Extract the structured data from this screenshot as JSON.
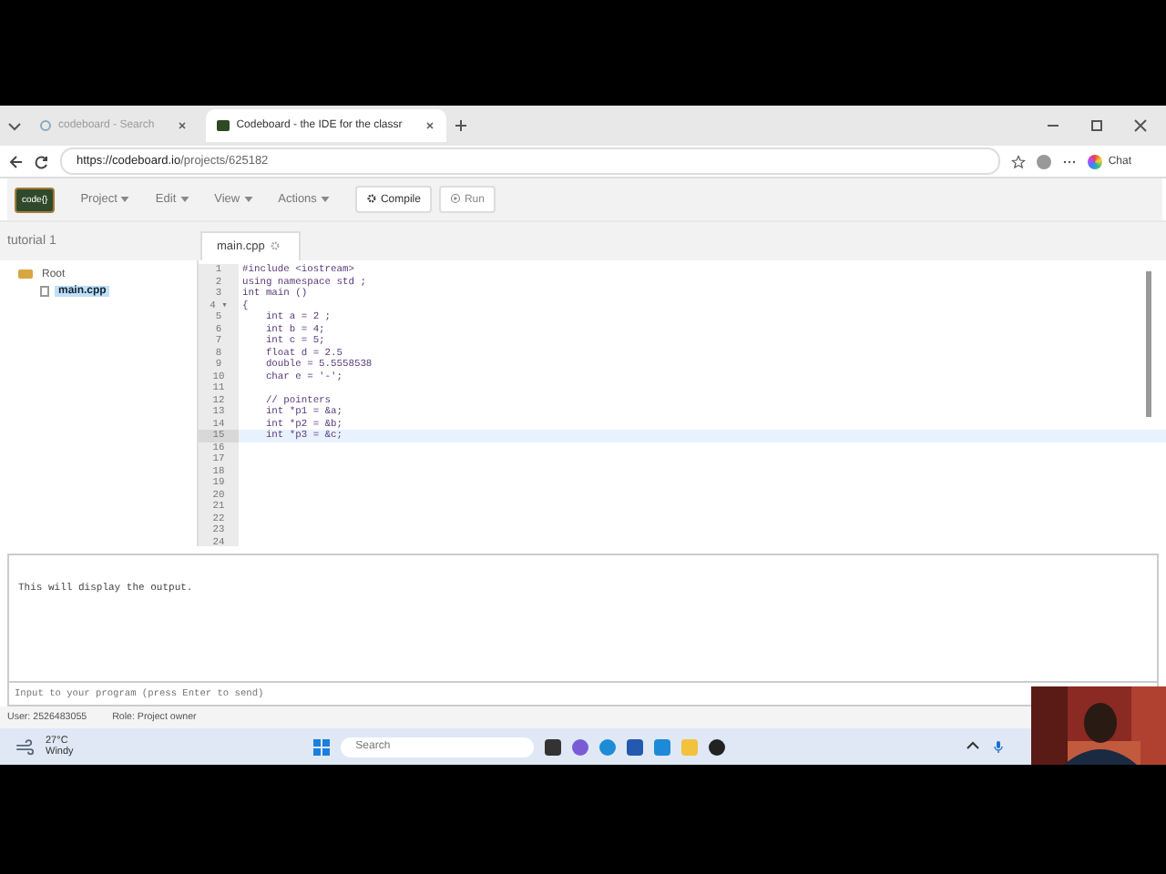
{
  "browser": {
    "tabs": [
      {
        "title": "codeboard - Search",
        "selected": false
      },
      {
        "title": "Codeboard - the IDE for the classr",
        "selected": true
      }
    ],
    "url_host": "https://codeboard.io",
    "url_path": "/projects/625182",
    "chat": "Chat"
  },
  "app": {
    "logo": "code{}",
    "menus": [
      "Project",
      "Edit",
      "View",
      "Actions"
    ],
    "buttons": [
      {
        "kind": "compile",
        "label": "Compile"
      },
      {
        "kind": "run",
        "label": "Run"
      }
    ],
    "project": "tutorial 1",
    "tree": [
      {
        "label": "Root",
        "selected": false,
        "children": [
          {
            "label": "main.cpp",
            "selected": true
          }
        ]
      }
    ],
    "editor_tab": "main.cpp",
    "lines": [
      {
        "n": "1",
        "text": "#include <iostream>",
        "current": false
      },
      {
        "n": "2",
        "text": "using namespace std ;",
        "current": false
      },
      {
        "n": "3",
        "text": "int main ()",
        "current": false
      },
      {
        "n": "4 ▾",
        "text": "{",
        "current": false
      },
      {
        "n": "5",
        "text": "    int a = 2 ;",
        "current": false
      },
      {
        "n": "6",
        "text": "    int b = 4;",
        "current": false
      },
      {
        "n": "7",
        "text": "    int c = 5;",
        "current": false
      },
      {
        "n": "8",
        "text": "    float d = 2.5",
        "current": false
      },
      {
        "n": "9",
        "text": "    double = 5.5558538",
        "current": false
      },
      {
        "n": "10",
        "text": "    char e = '-';",
        "current": false
      },
      {
        "n": "11",
        "current": false
      },
      {
        "n": "12",
        "text": "    // pointers",
        "current": false
      },
      {
        "n": "13",
        "text": "    int *p1 = &a;",
        "current": false
      },
      {
        "n": "14",
        "text": "    int *p2 = &b;",
        "current": false
      },
      {
        "n": "15",
        "text": "    int *p3 = &c;",
        "current": true
      },
      {
        "n": "16",
        "current": false
      },
      {
        "n": "17",
        "current": false
      },
      {
        "n": "18",
        "current": false
      },
      {
        "n": "19",
        "current": false
      },
      {
        "n": "20",
        "current": false
      },
      {
        "n": "21",
        "current": false
      },
      {
        "n": "22",
        "current": false
      },
      {
        "n": "23",
        "current": false
      },
      {
        "n": "24",
        "current": false
      }
    ],
    "output": "This will display the output.",
    "input_placeholder": "Input to your program (press Enter to send)",
    "user": "User: 2526483055",
    "role": "Role: Project owner"
  },
  "taskbar": {
    "temperature": "27°C",
    "weather": "Windy",
    "search_placeholder": "Search"
  }
}
